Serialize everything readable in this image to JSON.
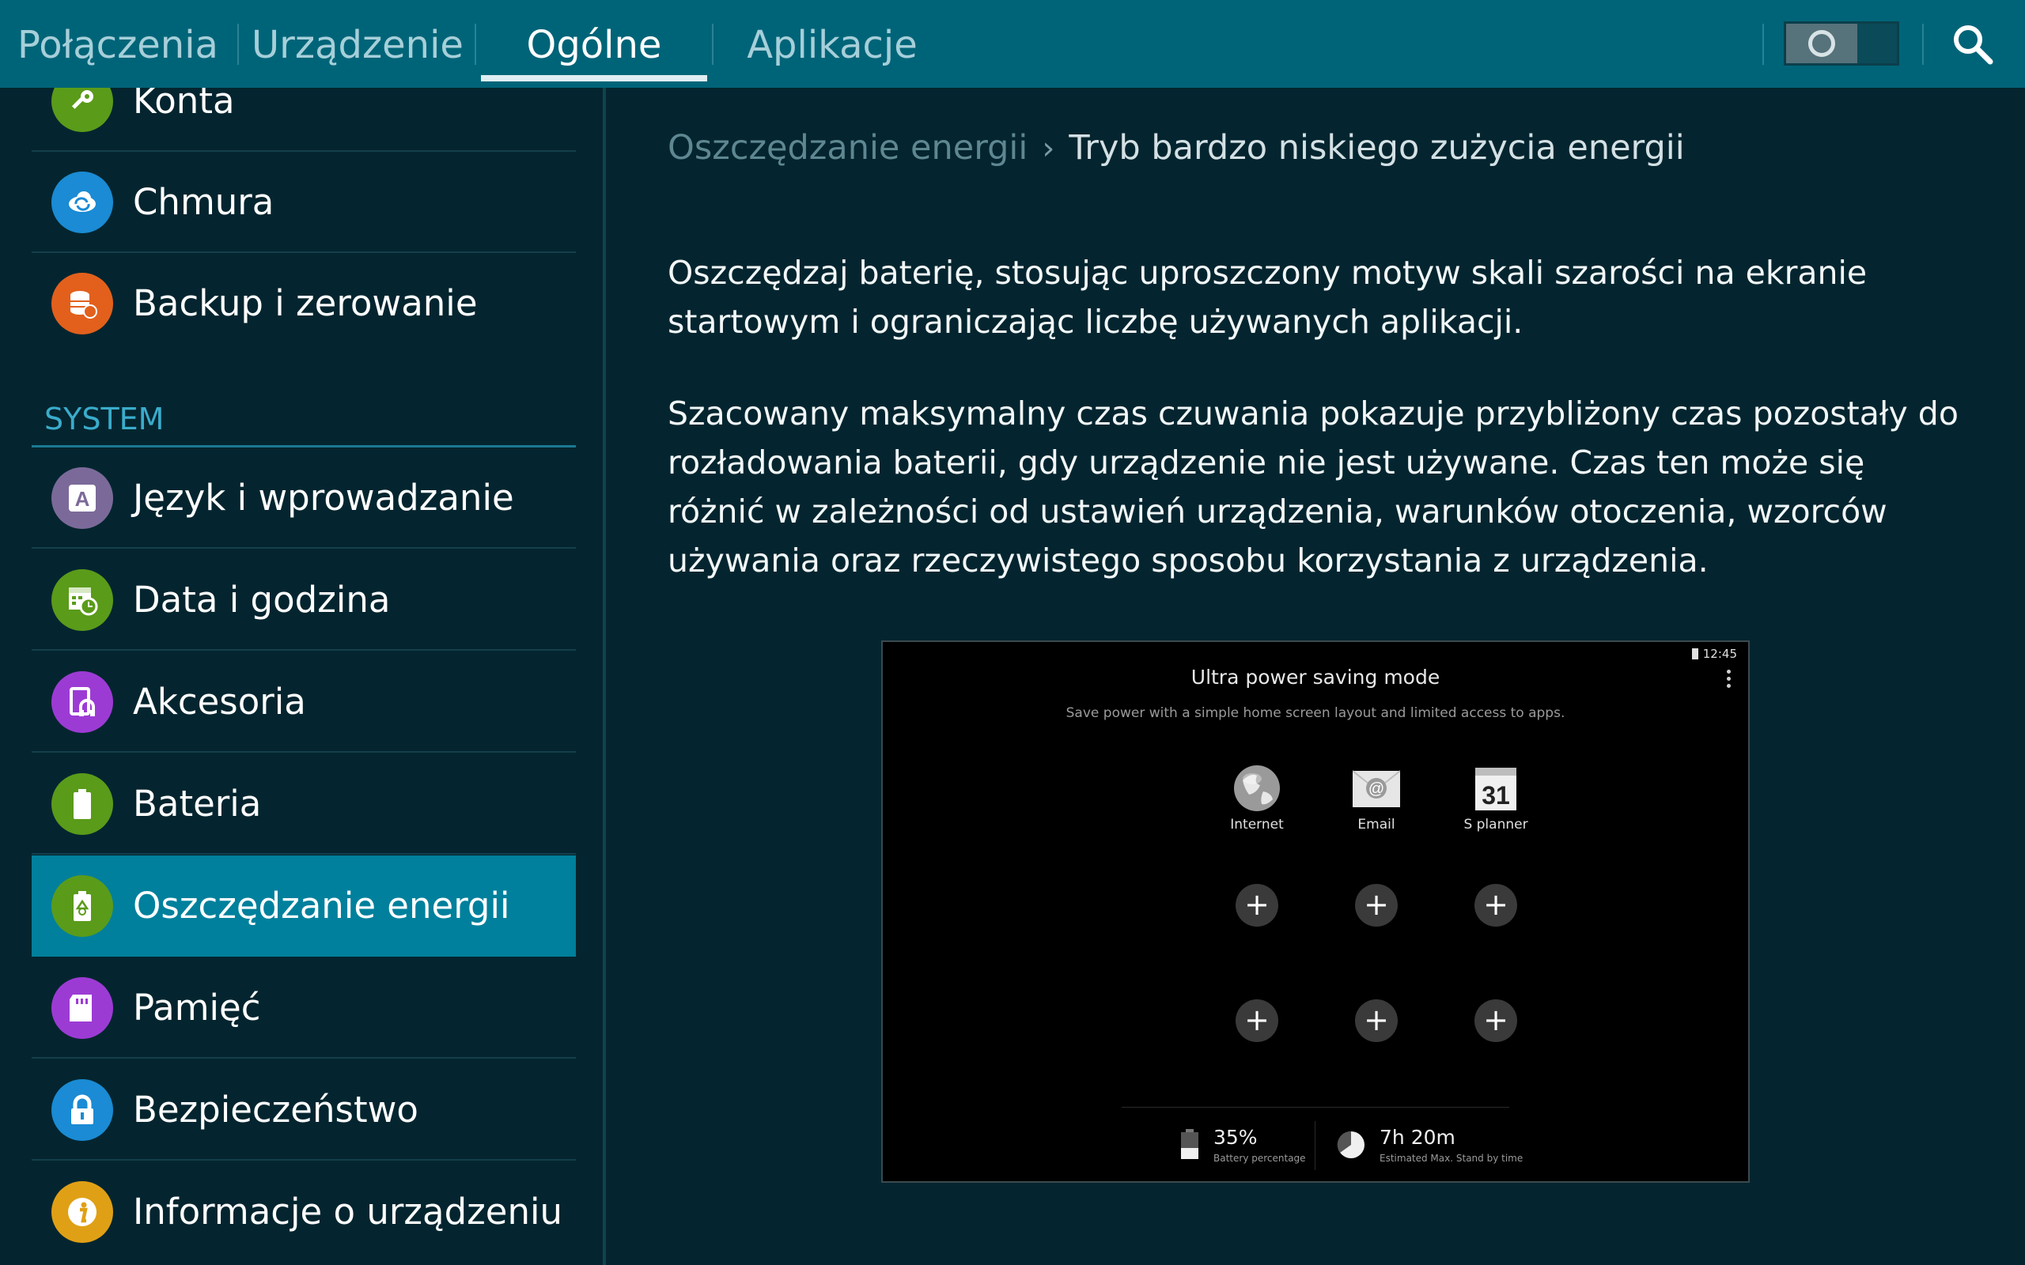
{
  "tabs": [
    {
      "label": "Połączenia",
      "active": false
    },
    {
      "label": "Urządzenie",
      "active": false
    },
    {
      "label": "Ogólne",
      "active": true
    },
    {
      "label": "Aplikacje",
      "active": false
    }
  ],
  "master_toggle": {
    "state": "off"
  },
  "sidebar": {
    "items_top": [
      {
        "label": "Konta",
        "icon": "key-icon",
        "color": "#5a9b1a"
      },
      {
        "label": "Chmura",
        "icon": "cloud-sync-icon",
        "color": "#1a8bd4"
      },
      {
        "label": "Backup i zerowanie",
        "icon": "backup-icon",
        "color": "#e2601c"
      }
    ],
    "section_title": "SYSTEM",
    "items_system": [
      {
        "label": "Język i wprowadzanie",
        "icon": "keyboard-a-icon",
        "color": "#7b6a99"
      },
      {
        "label": "Data i godzina",
        "icon": "calendar-clock-icon",
        "color": "#5a9b1a"
      },
      {
        "label": "Akcesoria",
        "icon": "accessory-icon",
        "color": "#9c3bd4"
      },
      {
        "label": "Bateria",
        "icon": "battery-icon",
        "color": "#5a9b1a"
      },
      {
        "label": "Oszczędzanie energii",
        "icon": "power-saving-icon",
        "color": "#5a9b1a",
        "selected": true
      },
      {
        "label": "Pamięć",
        "icon": "sd-card-icon",
        "color": "#9c3bd4"
      },
      {
        "label": "Bezpieczeństwo",
        "icon": "lock-icon",
        "color": "#1a8bd4"
      },
      {
        "label": "Informacje o urządzeniu",
        "icon": "info-icon",
        "color": "#e0a016"
      }
    ]
  },
  "content": {
    "breadcrumb_parent": "Oszczędzanie energii",
    "breadcrumb_separator": "›",
    "breadcrumb_current": "Tryb bardzo niskiego zużycia energii",
    "paragraph_1": "Oszczędzaj baterię, stosując uproszczony motyw skali szarości na ekranie startowym i ograniczając liczbę używanych aplikacji.",
    "paragraph_2": "Szacowany maksymalny czas czuwania pokazuje przybliżony czas pozostały do rozładowania baterii, gdy urządzenie nie jest używane. Czas ten może się różnić w zależności od ustawień urządzenia, warunków otoczenia, wzorców używania oraz rzeczywistego sposobu korzystania z urządzenia."
  },
  "preview": {
    "clock": "12:45",
    "title": "Ultra power saving mode",
    "subtitle": "Save power with a simple home screen layout and limited access to apps.",
    "apps": [
      {
        "label": "Internet",
        "icon": "globe-icon"
      },
      {
        "label": "Email",
        "icon": "email-icon"
      },
      {
        "label": "S planner",
        "icon": "calendar-icon",
        "badge": "31"
      }
    ],
    "add_slots": 6,
    "battery_value": "35%",
    "battery_label": "Battery percentage",
    "standby_value": "7h 20m",
    "standby_label": "Estimated Max. Stand by time"
  }
}
